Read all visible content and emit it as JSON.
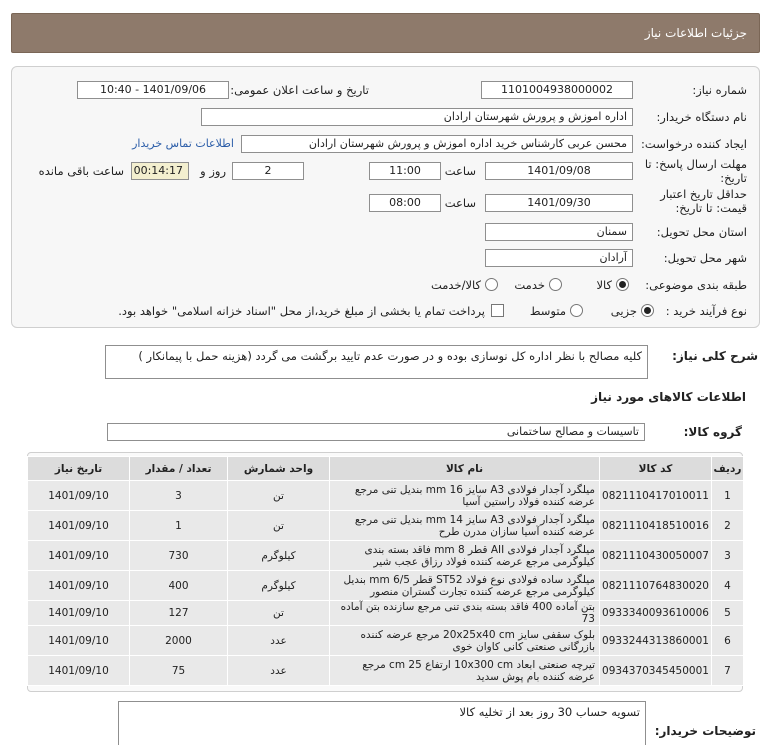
{
  "header": {
    "title": "جزئیات اطلاعات نیاز"
  },
  "fields": {
    "need_number_label": "شماره نیاز:",
    "need_number": "1101004938000002",
    "announce_label": "تاریخ و ساعت اعلان عمومی:",
    "announce_value": "1401/09/06 - 10:40",
    "buyer_org_label": "نام دستگاه خریدار:",
    "buyer_org": "اداره اموزش و پرورش شهرستان ارادان",
    "requester_label": "ایجاد کننده درخواست:",
    "requester": "محسن عربی کارشناس خرید اداره اموزش و پرورش شهرستان ارادان",
    "contact_link": "اطلاعات تماس خریدار",
    "deadline_label": "مهلت ارسال پاسخ: تا",
    "deadline_label2": "تاریخ:",
    "deadline_date": "1401/09/08",
    "time_word": "ساعت",
    "deadline_time": "11:00",
    "days_value": "2",
    "days_word": "روز و",
    "remaining_time": "00:14:17",
    "remaining_word": "ساعت باقی مانده",
    "validity_label": "حداقل تاریخ اعتبار",
    "validity_label2": "قیمت: تا تاریخ:",
    "validity_date": "1401/09/30",
    "validity_time": "08:00",
    "province_label": "استان محل تحویل:",
    "province": "سمنان",
    "city_label": "شهر محل تحویل:",
    "city": "آرادان",
    "category_label": "طبقه بندی موضوعی:",
    "category_options": [
      "کالا",
      "خدمت",
      "کالا/خدمت"
    ],
    "purchase_label": "نوع فرآیند خرید :",
    "purchase_options": [
      "جزیی",
      "متوسط"
    ],
    "payment_note": "پرداخت تمام یا بخشی از مبلغ خرید،از محل \"اسناد خزانه اسلامی\" خواهد بود."
  },
  "summary": {
    "label": "شرح کلی نیاز:",
    "text": "کلیه مصالح با نظر اداره کل نوسازی بوده و در صورت عدم تایید برگشت می گردد (هزینه حمل با پیمانکار )"
  },
  "goods_section": {
    "title": "اطلاعات کالاهای مورد نیاز",
    "group_label": "گروه کالا:",
    "group_value": "تاسیسات و مصالح ساختمانی"
  },
  "table": {
    "headers": [
      "ردیف",
      "کد کالا",
      "نام کالا",
      "واحد شمارش",
      "تعداد / مقدار",
      "تاریخ نیاز"
    ],
    "rows": [
      [
        "1",
        "0821110417010011",
        "میلگرد آجدار فولادی A3 سایز 16 mm بندیل تنی مرجع عرضه کننده فولاد راستین آسیا",
        "تن",
        "3",
        "1401/09/10"
      ],
      [
        "2",
        "0821110418510016",
        "میلگرد آجدار فولادی A3 سایز 14 mm بندیل تنی مرجع عرضه کننده آسیا سازان مدرن طرح",
        "تن",
        "1",
        "1401/09/10"
      ],
      [
        "3",
        "0821110430050007",
        "میلگرد آجدار فولادی AII قطر 8 mm فاقد بسته بندی کیلوگرمی مرجع عرضه کننده فولاد رزاق عجب شیر",
        "کیلوگرم",
        "730",
        "1401/09/10"
      ],
      [
        "4",
        "0821110764830020",
        "میلگرد ساده فولادی نوع فولاد ST52 قطر 6/5 mm بندیل کیلوگرمی مرجع عرضه کننده تجارت گستران منصور",
        "کیلوگرم",
        "400",
        "1401/09/10"
      ],
      [
        "5",
        "0933340093610006",
        "بتن آماده 400 فاقد بسته بندی تنی مرجع سازنده بتن آماده 73",
        "تن",
        "127",
        "1401/09/10"
      ],
      [
        "6",
        "0933244313860001",
        "بلوک سقفی سایز 20x25x40 cm مرجع عرضه کننده بازرگانی صنعتی کانی کاوان خوی",
        "عدد",
        "2000",
        "1401/09/10"
      ],
      [
        "7",
        "0934370345450001",
        "تیرچه صنعتی ابعاد 10x300 cm ارتفاع 25 cm مرجع عرضه کننده بام پوش سدید",
        "عدد",
        "75",
        "1401/09/10"
      ]
    ]
  },
  "notes": {
    "label": "توضیحات خریدار:",
    "text": "تسویه حساب 30 روز بعد از تخلیه کالا"
  }
}
